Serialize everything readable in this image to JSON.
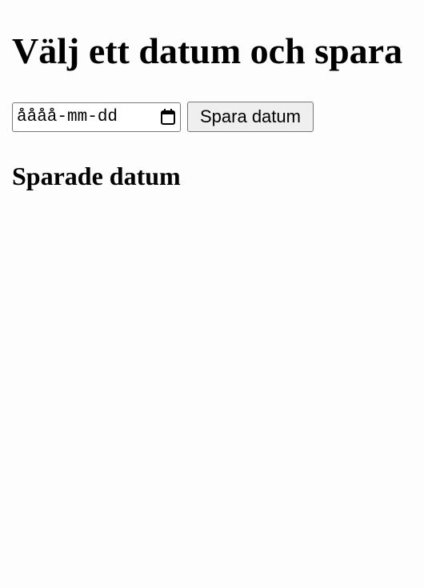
{
  "header": {
    "title": "Välj ett datum och spara"
  },
  "form": {
    "date_placeholder": "åååå-mm-dd",
    "calendar_icon": "calendar-icon",
    "save_label": "Spara datum"
  },
  "saved": {
    "heading": "Sparade datum",
    "items": []
  }
}
